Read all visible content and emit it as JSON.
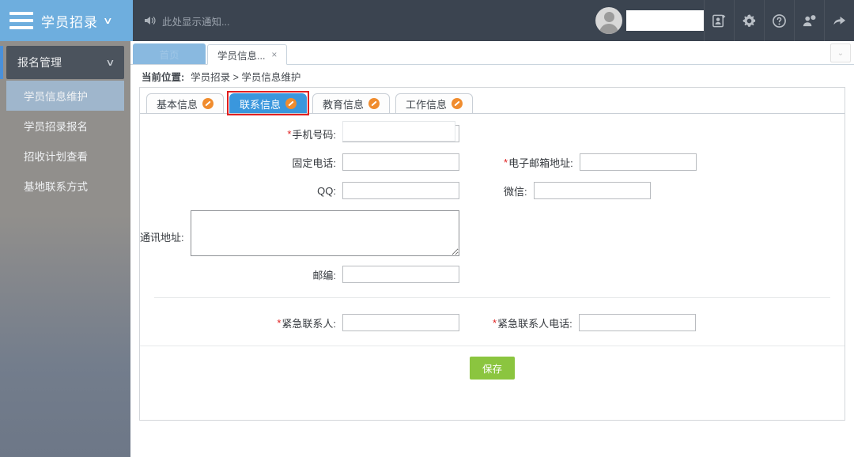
{
  "header": {
    "menu_icon": "hamburger-icon",
    "brand": "学员招录",
    "brand_caret": "∨",
    "notice_icon": "speaker-icon",
    "notice_text": "此处显示通知...",
    "avatar_icon": "avatar-icon",
    "username_value": "",
    "icons": [
      {
        "name": "add-contact-icon",
        "glyph": "id-card"
      },
      {
        "name": "gear-icon",
        "glyph": "gear"
      },
      {
        "name": "help-icon",
        "glyph": "question"
      },
      {
        "name": "user-badge-icon",
        "glyph": "person-alert"
      },
      {
        "name": "share-icon",
        "glyph": "forward-arrow"
      }
    ]
  },
  "sidebar": {
    "group_title": "报名管理",
    "group_caret": "∨",
    "items": [
      {
        "label": "学员信息维护",
        "active": true
      },
      {
        "label": "学员招录报名",
        "active": false
      },
      {
        "label": "招收计划查看",
        "active": false
      },
      {
        "label": "基地联系方式",
        "active": false
      }
    ]
  },
  "window_tabs": {
    "tabs": [
      {
        "label": "首页",
        "closable": false,
        "active": false
      },
      {
        "label": "学员信息...",
        "closable": true,
        "close_glyph": "×",
        "active": true
      }
    ],
    "more_glyph": "⌄"
  },
  "breadcrumb": {
    "label": "当前位置:",
    "path": "学员招录 > 学员信息维护"
  },
  "form_tabs": [
    {
      "label": "基本信息",
      "badge": "edit-badge-icon",
      "active": false
    },
    {
      "label": "联系信息",
      "badge": "edit-badge-icon",
      "active": true
    },
    {
      "label": "教育信息",
      "badge": "edit-badge-icon",
      "active": false
    },
    {
      "label": "工作信息",
      "badge": "edit-badge-icon",
      "active": false
    }
  ],
  "form": {
    "mobile": {
      "label": "手机号码:",
      "required": true,
      "value": "",
      "masked": true
    },
    "landline": {
      "label": "固定电话:",
      "required": false,
      "value": ""
    },
    "email": {
      "label": "电子邮箱地址:",
      "required": true,
      "value": ""
    },
    "qq": {
      "label": "QQ:",
      "required": false,
      "value": ""
    },
    "wechat": {
      "label": "微信:",
      "required": false,
      "value": ""
    },
    "address": {
      "label": "通讯地址:",
      "required": false,
      "value": ""
    },
    "postcode": {
      "label": "邮编:",
      "required": false,
      "value": ""
    },
    "emergency_contact": {
      "label": "紧急联系人:",
      "required": true,
      "value": ""
    },
    "emergency_phone": {
      "label": "紧急联系人电话:",
      "required": true,
      "value": ""
    },
    "required_mark": "*",
    "save_label": "保存"
  },
  "colors": {
    "brand_blue": "#6eaede",
    "header_dark": "#3b4450",
    "accent_tab": "#3a97dd",
    "highlight_red": "#e02020",
    "badge_orange": "#f08c2e",
    "save_green": "#8bc53f"
  }
}
